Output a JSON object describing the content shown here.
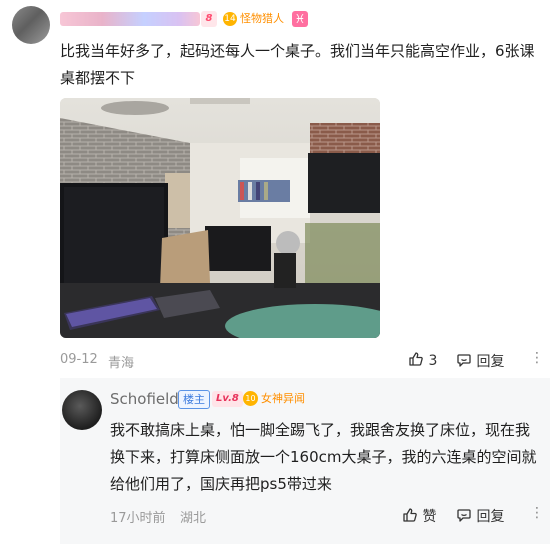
{
  "top_comment": {
    "level_badge": "8",
    "honor_icon": "14",
    "honor_title": "怪物猎人",
    "zodiac_icon": "♓",
    "text": "比我当年好多了，起码还每人一个桌子。我们当年只能高空作业，6张课桌都摆不下",
    "date": "09-12",
    "location": "青海",
    "like_count": "3",
    "reply_label": "回复",
    "more_icon": "⋮"
  },
  "reply": {
    "username": "Schofield",
    "op_tag": "楼主",
    "level": "Lv.8",
    "honor_icon": "10",
    "honor_title": "女神异闻",
    "text": "我不敢搞床上桌，怕一脚全踢飞了，我跟舍友换了床位，现在我换下来，打算床侧面放一个160cm大桌子，我的六连桌的空间就给他们用了，国庆再把ps5带过来",
    "time": "17小时前",
    "location": "湖北",
    "like_label": "赞",
    "reply_label": "回复",
    "more_icon": "⋮"
  },
  "colors": {
    "accent_orange": "#ff8f00",
    "op_tag_blue": "#3d7bde",
    "meta_gray": "#9a9a9a"
  }
}
